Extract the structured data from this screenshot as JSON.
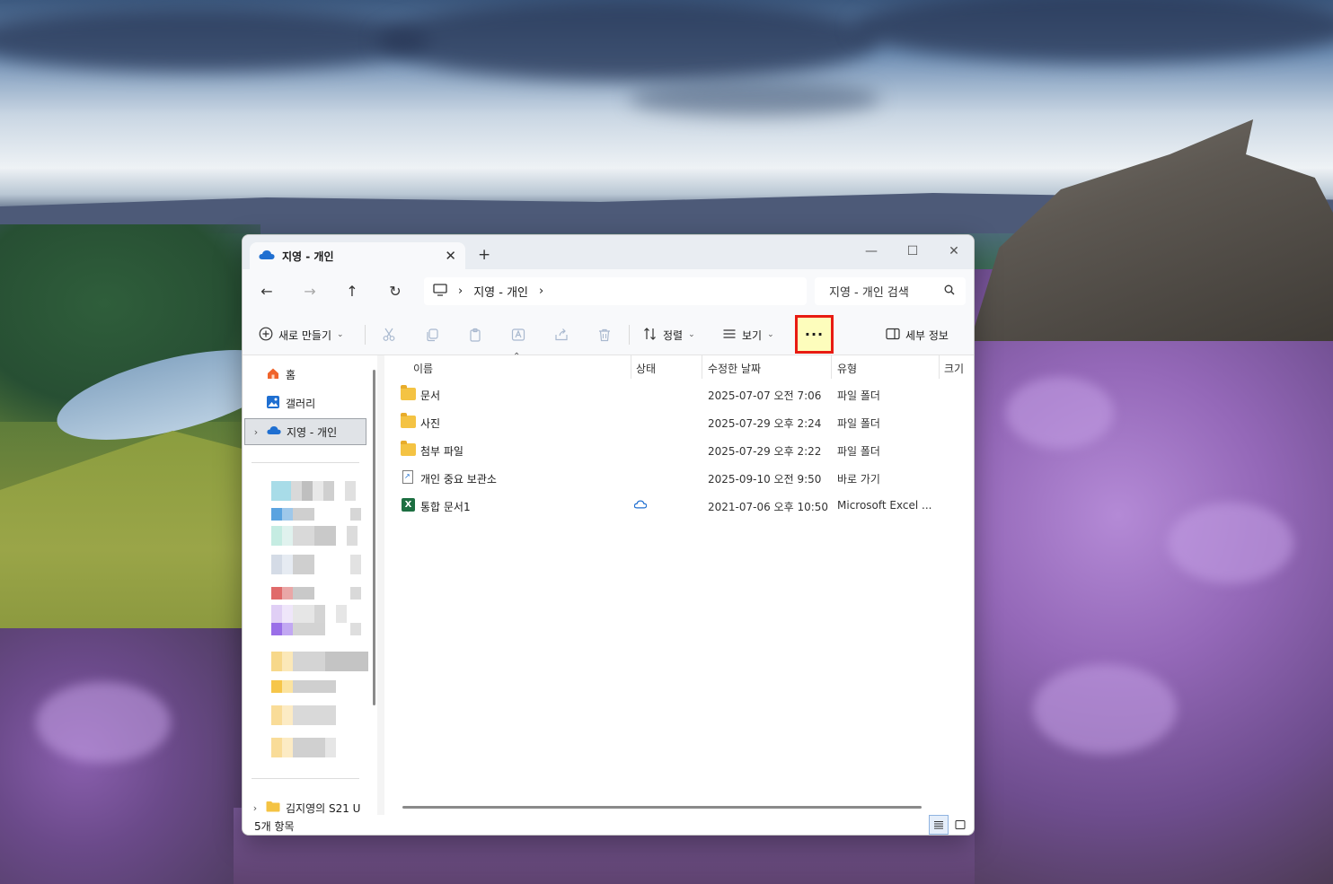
{
  "window": {
    "tab_title": "지영 - 개인",
    "new_tab": "+",
    "tab_close": "✕",
    "minimize": "—",
    "maximize": "☐",
    "close": "✕"
  },
  "nav": {
    "back": "←",
    "forward": "→",
    "up": "↑",
    "refresh": "↻",
    "breadcrumb_sep": "›",
    "breadcrumb": "지영 - 개인",
    "search_placeholder": "지영 - 개인 검색"
  },
  "toolbar": {
    "new_label": "새로 만들기",
    "sort_label": "정렬",
    "view_label": "보기",
    "more_label": "···",
    "details_label": "세부 정보",
    "chevron": "⌄"
  },
  "sidebar": {
    "home": "홈",
    "gallery": "갤러리",
    "onedrive": "지영 - 개인",
    "device": "김지영의 S21 U",
    "expand": "›"
  },
  "columns": {
    "name": "이름",
    "status": "상태",
    "modified": "수정한 날짜",
    "type": "유형",
    "size": "크기"
  },
  "files": [
    {
      "name": "문서",
      "modified": "2025-07-07 오전 7:06",
      "type": "파일 폴더",
      "kind": "folder"
    },
    {
      "name": "사진",
      "modified": "2025-07-29 오후 2:24",
      "type": "파일 폴더",
      "kind": "folder"
    },
    {
      "name": "첨부 파일",
      "modified": "2025-07-29 오후 2:22",
      "type": "파일 폴더",
      "kind": "folder"
    },
    {
      "name": "개인 중요 보관소",
      "modified": "2025-09-10 오전 9:50",
      "type": "바로 가기",
      "kind": "shortcut"
    },
    {
      "name": "통합 문서1",
      "modified": "2021-07-06 오후 10:50",
      "type": "Microsoft Excel ...",
      "kind": "excel",
      "status": "cloud-icon"
    }
  ],
  "status": {
    "item_count": "5개 항목"
  },
  "colors": {
    "highlight_border": "#e81b12",
    "highlight_fill": "#fdfdbc",
    "folder": "#f4c343",
    "excel": "#1d6f42",
    "onedrive": "#1f6fd1"
  }
}
